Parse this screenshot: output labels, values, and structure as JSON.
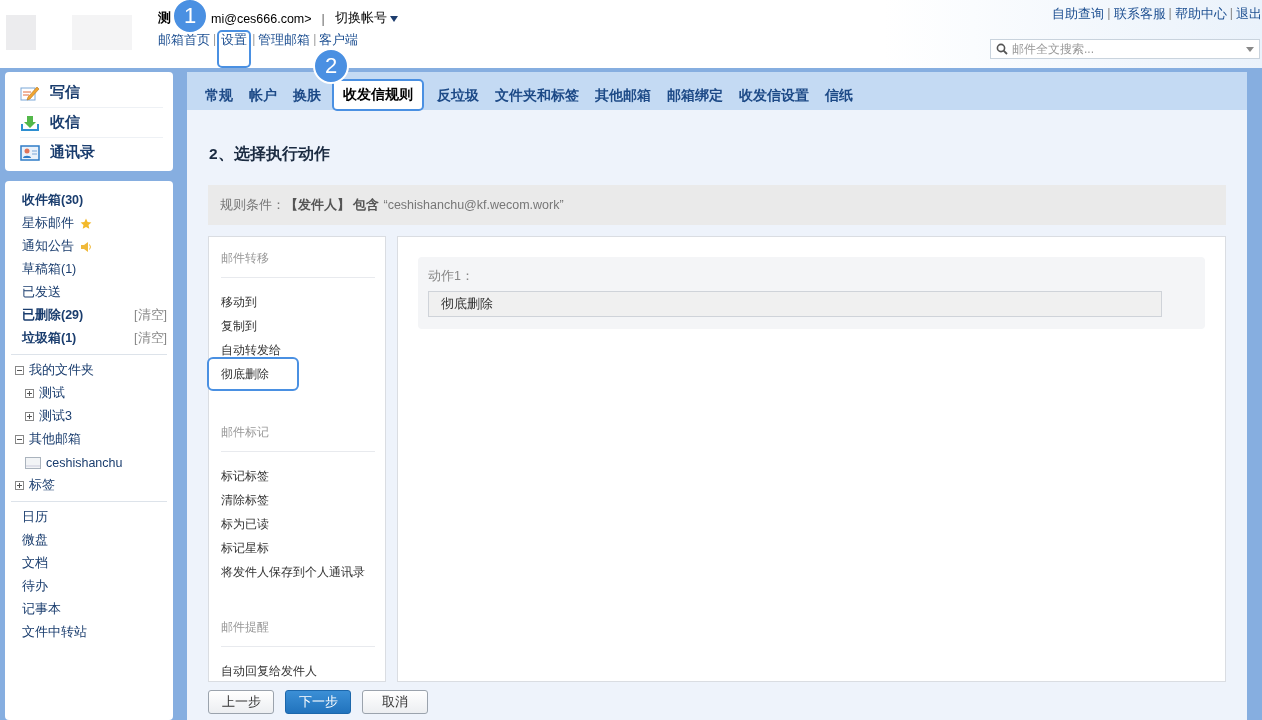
{
  "header": {
    "account_name": "测",
    "account_email": "mi@ces666.com>",
    "account_separator": "|",
    "switch_account": "切换帐号",
    "nav_links": [
      {
        "kind": "link",
        "text": "邮箱首页",
        "highlighted": false
      },
      {
        "kind": "sep",
        "text": "|"
      },
      {
        "kind": "link",
        "text": "设置",
        "highlighted": true
      },
      {
        "kind": "sep",
        "text": "|"
      },
      {
        "kind": "link",
        "text": "管理邮箱",
        "highlighted": false
      },
      {
        "kind": "sep",
        "text": "|"
      },
      {
        "kind": "link",
        "text": "客户端",
        "highlighted": false
      }
    ],
    "top_links": [
      {
        "kind": "link",
        "text": "自助查询"
      },
      {
        "kind": "sep",
        "text": "|"
      },
      {
        "kind": "link",
        "text": "联系客服"
      },
      {
        "kind": "sep",
        "text": "|"
      },
      {
        "kind": "link",
        "text": "帮助中心"
      },
      {
        "kind": "sep",
        "text": "|"
      },
      {
        "kind": "link",
        "text": "退出"
      }
    ],
    "search": {
      "placeholder": "邮件全文搜索..."
    }
  },
  "annotations": [
    {
      "number": "1"
    },
    {
      "number": "2"
    }
  ],
  "sidebar": {
    "quick_actions": [
      {
        "kind": "compose",
        "label": "写信"
      },
      {
        "kind": "receive",
        "label": "收信"
      },
      {
        "kind": "contacts",
        "label": "通讯录"
      }
    ],
    "folders": [
      {
        "label": "收件箱(30)",
        "bold": true,
        "kind": "plain"
      },
      {
        "label": "星标邮件",
        "bold": false,
        "kind": "star"
      },
      {
        "label": "通知公告",
        "bold": false,
        "kind": "notice"
      },
      {
        "label": "草稿箱(1)",
        "bold": false,
        "kind": "plain"
      },
      {
        "label": "已发送",
        "bold": false,
        "kind": "plain"
      },
      {
        "label": "已删除(29)",
        "bold": true,
        "kind": "plain",
        "action": "[清空]"
      },
      {
        "label": "垃圾箱(1)",
        "bold": true,
        "kind": "plain",
        "action": "[清空]"
      }
    ],
    "tree": [
      {
        "label": "我的文件夹",
        "kind": "folder",
        "expanded": true,
        "children": [
          {
            "label": "测试",
            "kind": "folder",
            "expanded": false
          },
          {
            "label": "测试3",
            "kind": "folder",
            "expanded": false
          }
        ]
      },
      {
        "label": "其他邮箱",
        "kind": "folder",
        "expanded": true,
        "children": [
          {
            "label": "ceshishanchu",
            "kind": "mailbox"
          }
        ]
      },
      {
        "label": "标签",
        "kind": "folder",
        "expanded": false
      }
    ],
    "apps": [
      "日历",
      "微盘",
      "文档",
      "待办",
      "记事本",
      "文件中转站"
    ]
  },
  "tabs": [
    {
      "label": "常规",
      "selected": false
    },
    {
      "label": "帐户",
      "selected": false
    },
    {
      "label": "换肤",
      "selected": false
    },
    {
      "label": "收发信规则",
      "selected": true
    },
    {
      "label": "反垃圾",
      "selected": false
    },
    {
      "label": "文件夹和标签",
      "selected": false
    },
    {
      "label": "其他邮箱",
      "selected": false
    },
    {
      "label": "邮箱绑定",
      "selected": false
    },
    {
      "label": "收发信设置",
      "selected": false
    },
    {
      "label": "信纸",
      "selected": false
    }
  ],
  "content": {
    "heading": "2、选择执行动作",
    "condition": "规则条件： **【发件人】 包含** “ceshishanchu@kf.wecom.work”",
    "action_groups": [
      {
        "title": "邮件转移",
        "items": [
          {
            "label": "移动到",
            "highlighted": false
          },
          {
            "label": "复制到",
            "highlighted": false
          },
          {
            "label": "自动转发给",
            "highlighted": false
          },
          {
            "label": "彻底删除",
            "highlighted": true
          }
        ]
      },
      {
        "title": "邮件标记",
        "items": [
          {
            "label": "标记标签",
            "highlighted": false
          },
          {
            "label": "清除标签",
            "highlighted": false
          },
          {
            "label": "标为已读",
            "highlighted": false
          },
          {
            "label": "标记星标",
            "highlighted": false
          },
          {
            "label": "将发件人保存到个人通讯录",
            "highlighted": false
          }
        ]
      },
      {
        "title": "邮件提醒",
        "items": [
          {
            "label": "自动回复给发件人",
            "highlighted": false
          }
        ]
      }
    ],
    "actions": [
      {
        "label": "动作1：",
        "value": "彻底删除"
      }
    ],
    "buttons": [
      {
        "label": "上一步",
        "kind": "default"
      },
      {
        "label": "下一步",
        "kind": "primary"
      },
      {
        "label": "取消",
        "kind": "default"
      }
    ]
  }
}
